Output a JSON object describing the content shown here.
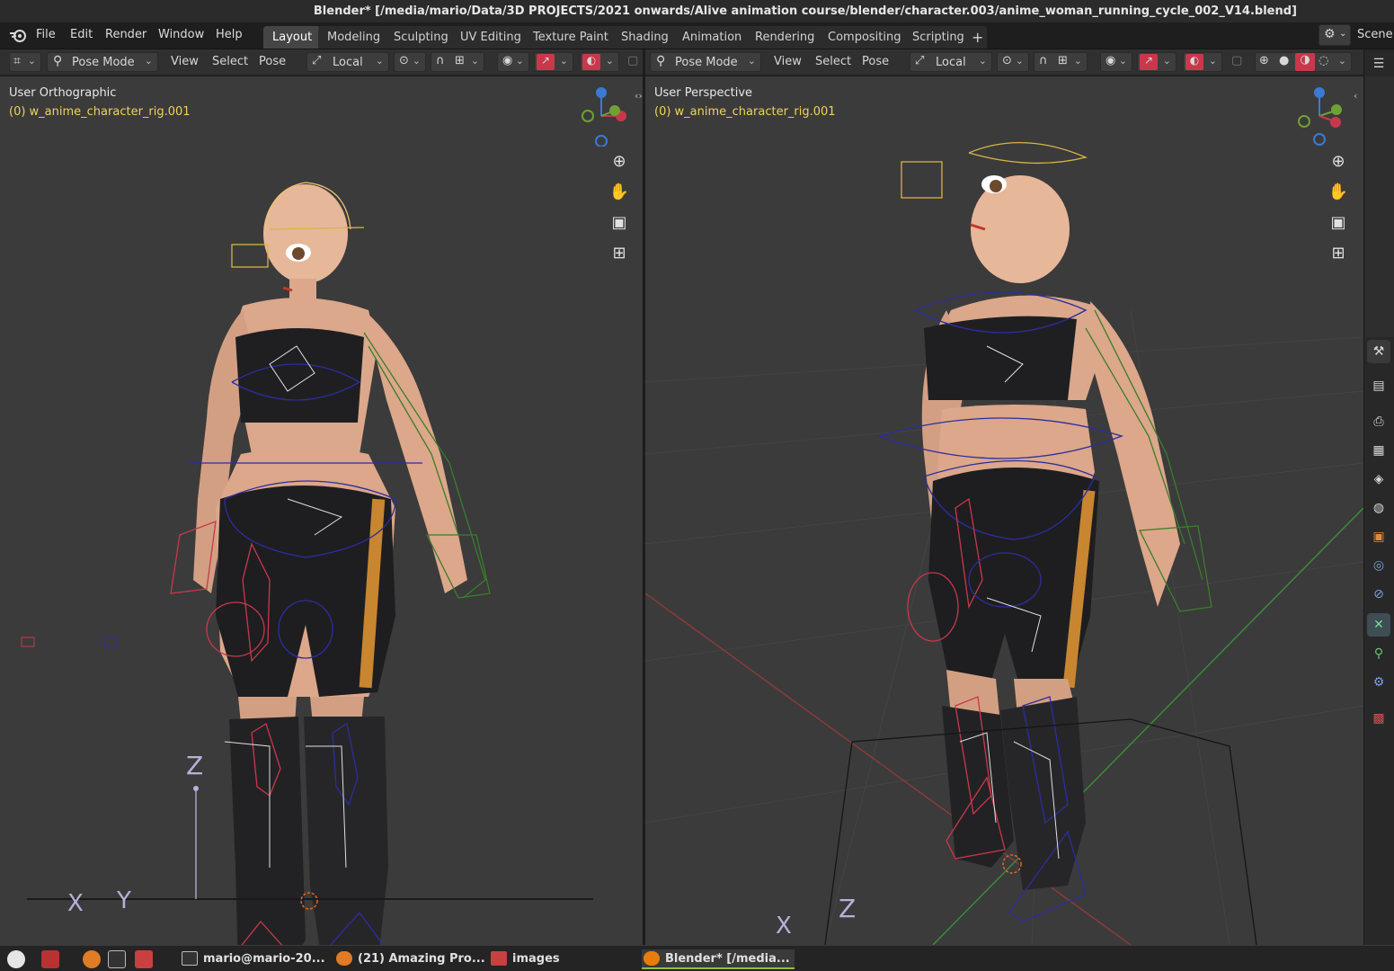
{
  "window": {
    "title": "Blender* [/media/mario/Data/3D PROJECTS/2021 onwards/Alive animation course/blender/character.003/anime_woman_running_cycle_002_V14.blend]"
  },
  "menubar": {
    "menus": [
      "File",
      "Edit",
      "Render",
      "Window",
      "Help"
    ],
    "workspaces": [
      "Layout",
      "Modeling",
      "Sculpting",
      "UV Editing",
      "Texture Paint",
      "Shading",
      "Animation",
      "Rendering",
      "Compositing",
      "Scripting"
    ],
    "active_workspace": "Layout",
    "add_workspace": "+",
    "scene_label": "Scene"
  },
  "viewport_left": {
    "mode": "Pose Mode",
    "menus": [
      "View",
      "Select",
      "Pose"
    ],
    "transform_orientation": "Local",
    "view_label": "User Orthographic",
    "object_label": "(0) w_anime_character_rig.001",
    "axis_labels": {
      "x": "X",
      "y": "Y",
      "z": "Z"
    }
  },
  "viewport_right": {
    "mode": "Pose Mode",
    "menus": [
      "View",
      "Select",
      "Pose"
    ],
    "transform_orientation": "Local",
    "view_label": "User Perspective",
    "object_label": "(0) w_anime_character_rig.001",
    "axis_labels": {
      "x": "X",
      "z": "Z"
    }
  },
  "colors": {
    "axis_x": "#c9384a",
    "axis_y": "#6fa134",
    "axis_z": "#3b79d6",
    "object_text": "#f0d25a",
    "active_tab": "#454545"
  },
  "taskbar": {
    "items": [
      {
        "label": "mario@mario-20...",
        "icon": "terminal-icon"
      },
      {
        "label": "(21) Amazing Pro...",
        "icon": "firefox-icon"
      },
      {
        "label": "images",
        "icon": "folder-icon"
      },
      {
        "label": "Blender* [/media...",
        "icon": "blender-icon"
      }
    ]
  }
}
